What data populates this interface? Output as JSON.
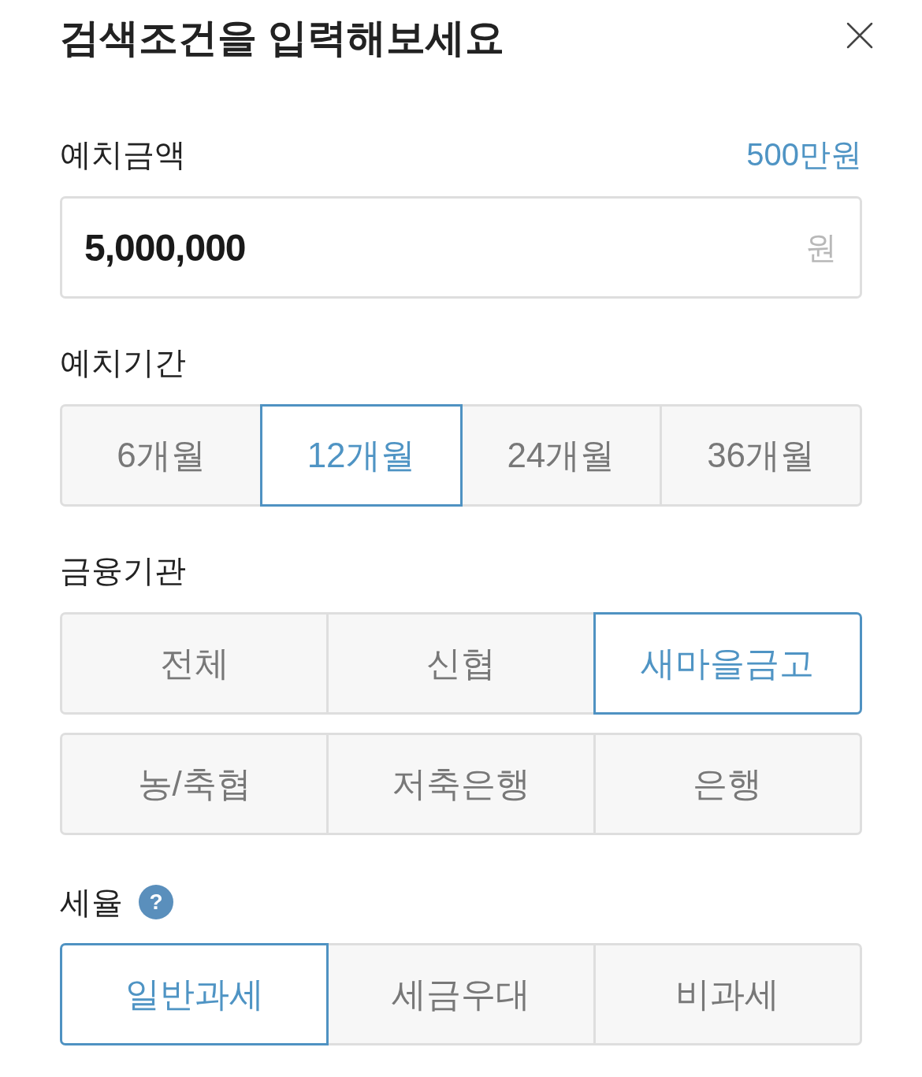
{
  "header": {
    "title": "검색조건을 입력해보세요"
  },
  "amount": {
    "label": "예치금액",
    "summary": "500만원",
    "value": "5,000,000",
    "unit": "원"
  },
  "period": {
    "label": "예치기간",
    "options": [
      {
        "label": "6개월",
        "selected": false
      },
      {
        "label": "12개월",
        "selected": true
      },
      {
        "label": "24개월",
        "selected": false
      },
      {
        "label": "36개월",
        "selected": false
      }
    ]
  },
  "institution": {
    "label": "금융기관",
    "options": [
      {
        "label": "전체",
        "selected": false
      },
      {
        "label": "신협",
        "selected": false
      },
      {
        "label": "새마을금고",
        "selected": true
      },
      {
        "label": "농/축협",
        "selected": false
      },
      {
        "label": "저축은행",
        "selected": false
      },
      {
        "label": "은행",
        "selected": false
      }
    ]
  },
  "tax": {
    "label": "세율",
    "help": "?",
    "options": [
      {
        "label": "일반과세",
        "selected": true
      },
      {
        "label": "세금우대",
        "selected": false
      },
      {
        "label": "비과세",
        "selected": false
      }
    ]
  }
}
